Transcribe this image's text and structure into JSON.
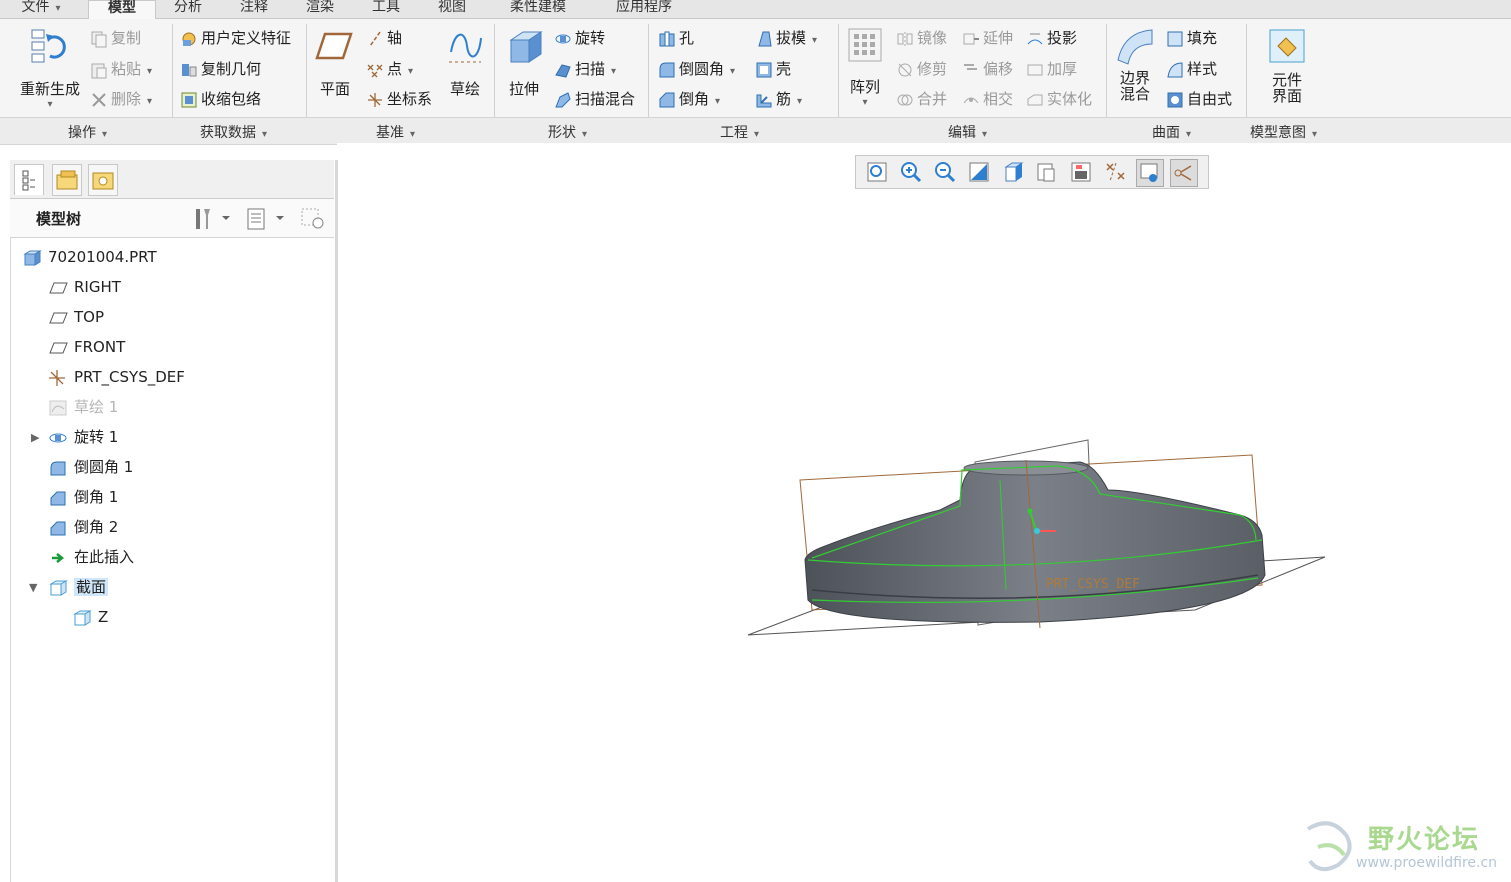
{
  "menu_tabs": [
    "文件",
    "模型",
    "分析",
    "注释",
    "渲染",
    "工具",
    "视图",
    "柔性建模",
    "应用程序"
  ],
  "ribbon": {
    "regen": "重新生成",
    "copy": "复制",
    "paste": "粘贴",
    "delete": "删除",
    "user_feature": "用户定义特征",
    "copy_geom": "复制几何",
    "shrinkwrap": "收缩包络",
    "plane": "平面",
    "axis": "轴",
    "point": "点",
    "csys": "坐标系",
    "sketch": "草绘",
    "extrude": "拉伸",
    "revolve": "旋转",
    "sweep": "扫描",
    "swept_blend": "扫描混合",
    "hole": "孔",
    "round": "倒圆角",
    "chamfer": "倒角",
    "draft": "拔模",
    "shell": "壳",
    "rib": "筋",
    "pattern": "阵列",
    "mirror": "镜像",
    "extend": "延伸",
    "project": "投影",
    "trim": "修剪",
    "offset": "偏移",
    "thicken": "加厚",
    "merge": "合并",
    "intersect": "相交",
    "solidify": "实体化",
    "boundary_blend_1": "边界",
    "boundary_blend_2": "混合",
    "fill": "填充",
    "style": "样式",
    "freestyle": "自由式",
    "component_1": "元件",
    "component_2": "界面"
  },
  "groups": [
    "操作",
    "获取数据",
    "基准",
    "形状",
    "工程",
    "编辑",
    "曲面",
    "模型意图"
  ],
  "panel": {
    "title": "模型树"
  },
  "tree": [
    {
      "label": "70201004.PRT",
      "icon": "part-icon"
    },
    {
      "label": "RIGHT",
      "icon": "datum-plane-icon"
    },
    {
      "label": "TOP",
      "icon": "datum-plane-icon"
    },
    {
      "label": "FRONT",
      "icon": "datum-plane-icon"
    },
    {
      "label": "PRT_CSYS_DEF",
      "icon": "csys-icon"
    },
    {
      "label": "草绘 1",
      "icon": "sketch-icon"
    },
    {
      "label": "旋转 1",
      "icon": "revolve-icon"
    },
    {
      "label": "倒圆角 1",
      "icon": "round-icon"
    },
    {
      "label": "倒角 1",
      "icon": "chamfer-icon"
    },
    {
      "label": "倒角 2",
      "icon": "chamfer-icon"
    },
    {
      "label": "在此插入",
      "icon": "insert-here-icon"
    },
    {
      "label": "截面",
      "icon": "section-icon"
    },
    {
      "label": "Z",
      "icon": "section-icon"
    }
  ],
  "viewport": {
    "csys_label": "PRT_CSYS_DEF"
  },
  "watermark": {
    "title": "野火论坛",
    "url": "www.proewildfire.cn"
  },
  "colors": {
    "accent": "#2f7fd1",
    "datum": "#a0683a",
    "edge_highlight": "#33cc33",
    "model": "#6b7078"
  }
}
